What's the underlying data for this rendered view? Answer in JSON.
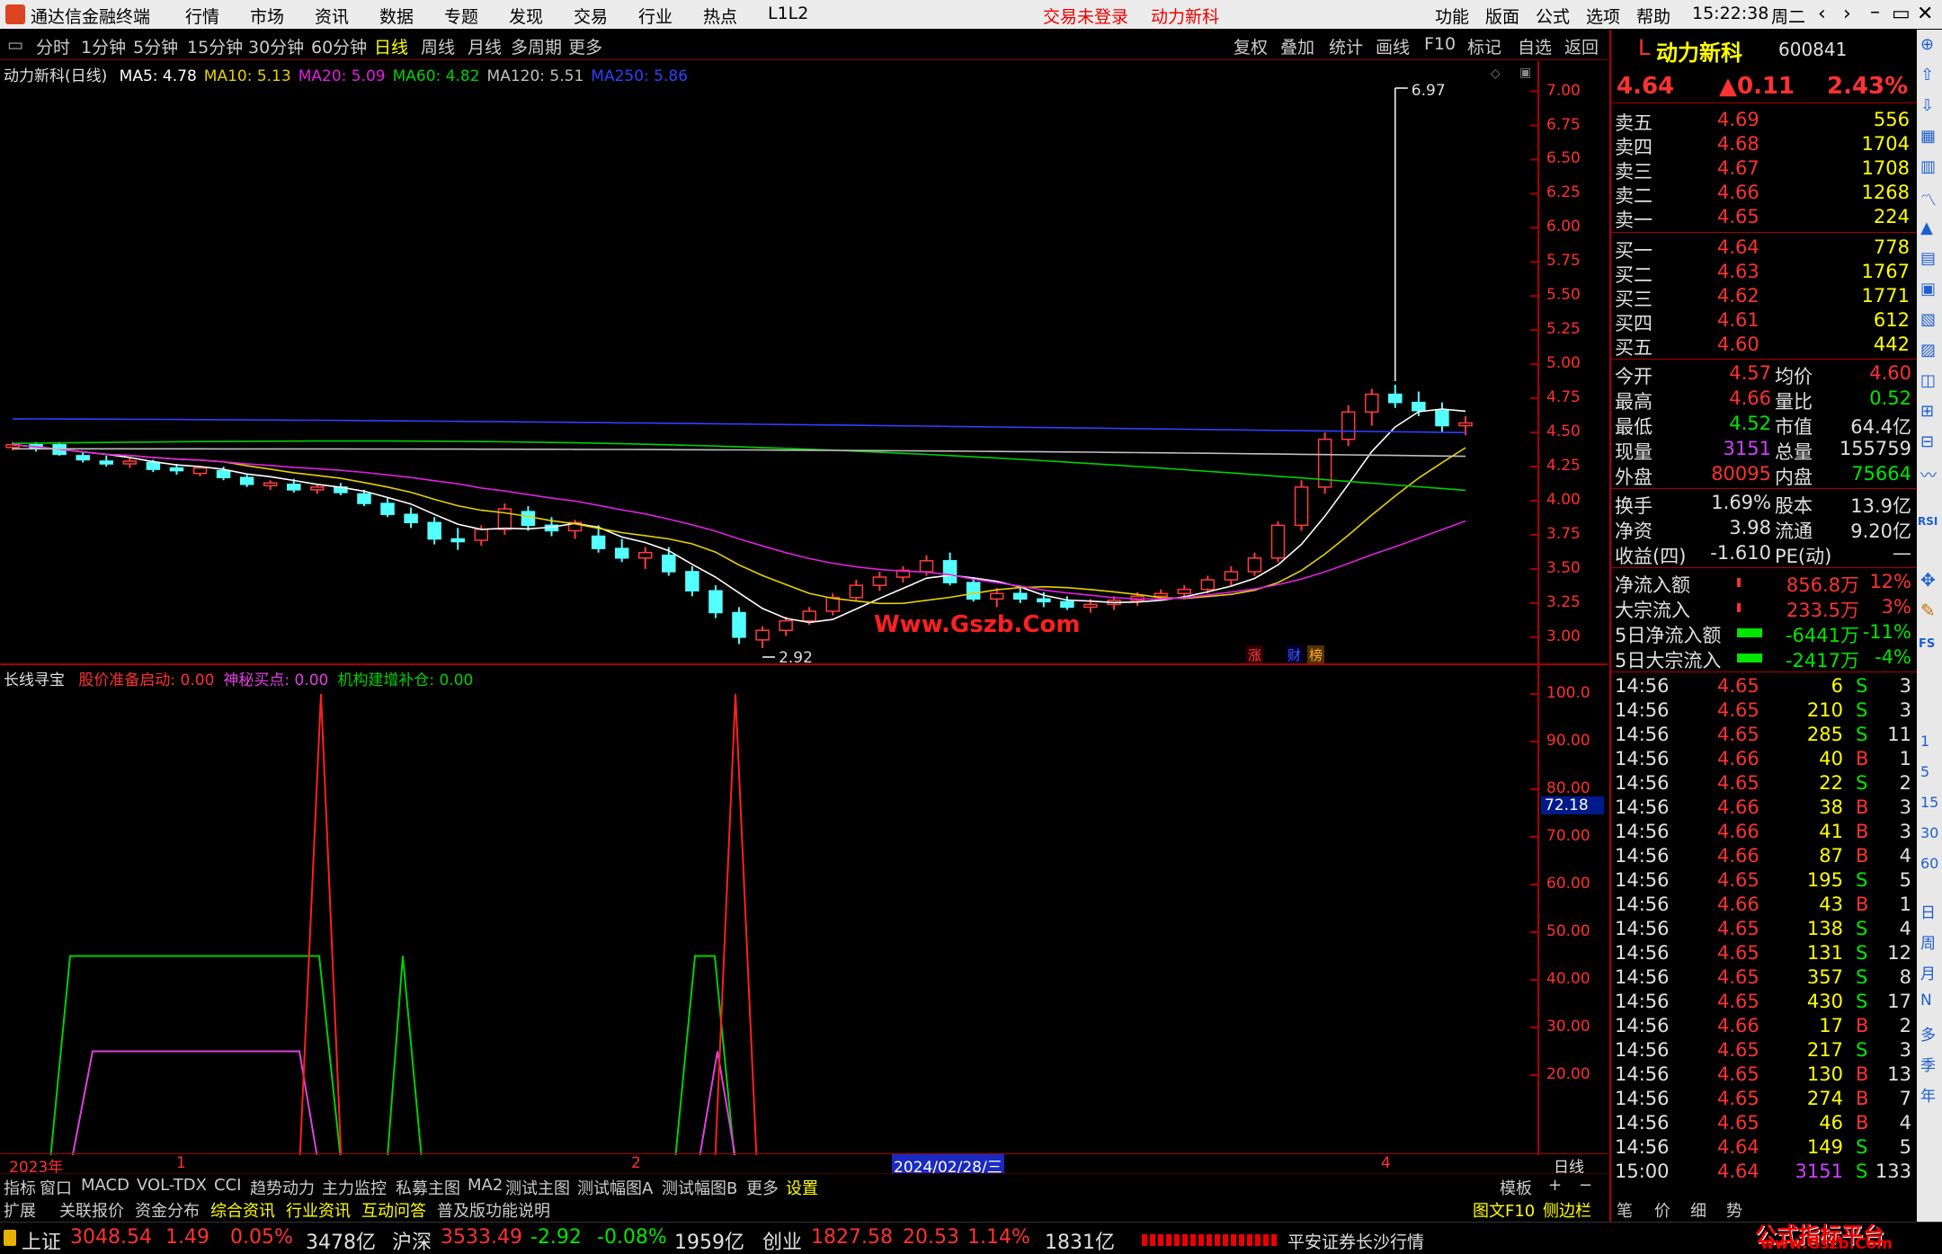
{
  "titlebar": {
    "app_name": "通达信金融终端",
    "menus": [
      "行情",
      "市场",
      "资讯",
      "数据",
      "专题",
      "发现",
      "交易",
      "行业",
      "热点",
      "L1L2"
    ],
    "login_status": "交易未登录",
    "stock_name_title": "动力新科",
    "right_menus": [
      "功能",
      "版面",
      "公式",
      "选项",
      "帮助"
    ],
    "time": "15:22:38",
    "weekday": "周二"
  },
  "toolbar": {
    "periods": [
      "分时",
      "1分钟",
      "5分钟",
      "15分钟",
      "30分钟",
      "60分钟",
      "日线",
      "周线",
      "月线",
      "多周期",
      "更多"
    ],
    "active_period": "日线",
    "actions": [
      "复权",
      "叠加",
      "统计",
      "画线",
      "F10",
      "标记",
      "自选",
      "返回"
    ]
  },
  "main_chart": {
    "title": "动力新科(日线)",
    "ma_labels": [
      {
        "label": "MA5: 4.78",
        "color": "#ffffff"
      },
      {
        "label": "MA10: 5.13",
        "color": "#e8d000"
      },
      {
        "label": "MA20: 5.09",
        "color": "#e020e0"
      },
      {
        "label": "MA60: 4.82",
        "color": "#00d000"
      },
      {
        "label": "MA120: 5.51",
        "color": "#c0c0c0"
      },
      {
        "label": "MA250: 5.86",
        "color": "#3040ff"
      }
    ],
    "y_ticks": [
      "7.00",
      "6.75",
      "6.50",
      "6.25",
      "6.00",
      "5.75",
      "5.50",
      "5.25",
      "5.00",
      "4.75",
      "4.50",
      "4.25",
      "4.00",
      "3.75",
      "3.50",
      "3.25",
      "3.00"
    ],
    "high_marker": "6.97",
    "low_marker": "2.92",
    "watermark": "Www.Gszb.Com",
    "badges": [
      "涨",
      "财",
      "榜"
    ]
  },
  "chart_data": {
    "type": "candlestick",
    "ylim": [
      2.9,
      7.05
    ],
    "candles": [
      [
        4.39,
        4.43,
        4.37,
        4.41
      ],
      [
        4.41,
        4.43,
        4.36,
        4.38
      ],
      [
        4.41,
        4.43,
        4.33,
        4.34
      ],
      [
        4.33,
        4.36,
        4.28,
        4.3
      ],
      [
        4.29,
        4.33,
        4.25,
        4.27
      ],
      [
        4.27,
        4.31,
        4.24,
        4.29
      ],
      [
        4.28,
        4.3,
        4.21,
        4.23
      ],
      [
        4.24,
        4.27,
        4.19,
        4.22
      ],
      [
        4.2,
        4.25,
        4.18,
        4.24
      ],
      [
        4.22,
        4.25,
        4.15,
        4.17
      ],
      [
        4.17,
        4.19,
        4.1,
        4.12
      ],
      [
        4.11,
        4.15,
        4.08,
        4.13
      ],
      [
        4.12,
        4.16,
        4.06,
        4.08
      ],
      [
        4.08,
        4.12,
        4.05,
        4.1
      ],
      [
        4.1,
        4.13,
        4.04,
        4.06
      ],
      [
        4.05,
        4.08,
        3.96,
        3.98
      ],
      [
        3.98,
        4.02,
        3.88,
        3.9
      ],
      [
        3.9,
        3.95,
        3.8,
        3.84
      ],
      [
        3.84,
        3.88,
        3.68,
        3.72
      ],
      [
        3.72,
        3.8,
        3.64,
        3.7
      ],
      [
        3.71,
        3.82,
        3.67,
        3.79
      ],
      [
        3.79,
        3.98,
        3.75,
        3.94
      ],
      [
        3.92,
        3.96,
        3.78,
        3.82
      ],
      [
        3.82,
        3.88,
        3.74,
        3.78
      ],
      [
        3.78,
        3.86,
        3.72,
        3.84
      ],
      [
        3.74,
        3.82,
        3.62,
        3.65
      ],
      [
        3.65,
        3.72,
        3.55,
        3.58
      ],
      [
        3.58,
        3.66,
        3.5,
        3.62
      ],
      [
        3.6,
        3.66,
        3.45,
        3.48
      ],
      [
        3.48,
        3.52,
        3.3,
        3.34
      ],
      [
        3.34,
        3.38,
        3.14,
        3.18
      ],
      [
        3.18,
        3.22,
        2.95,
        3.0
      ],
      [
        2.98,
        3.08,
        2.92,
        3.05
      ],
      [
        3.05,
        3.15,
        3.01,
        3.12
      ],
      [
        3.12,
        3.22,
        3.09,
        3.19
      ],
      [
        3.19,
        3.32,
        3.16,
        3.29
      ],
      [
        3.29,
        3.42,
        3.26,
        3.38
      ],
      [
        3.38,
        3.48,
        3.34,
        3.44
      ],
      [
        3.44,
        3.52,
        3.4,
        3.49
      ],
      [
        3.48,
        3.6,
        3.45,
        3.56
      ],
      [
        3.56,
        3.62,
        3.38,
        3.4
      ],
      [
        3.4,
        3.44,
        3.26,
        3.28
      ],
      [
        3.28,
        3.36,
        3.22,
        3.32
      ],
      [
        3.32,
        3.38,
        3.25,
        3.28
      ],
      [
        3.28,
        3.33,
        3.22,
        3.26
      ],
      [
        3.26,
        3.3,
        3.2,
        3.22
      ],
      [
        3.22,
        3.28,
        3.18,
        3.24
      ],
      [
        3.24,
        3.3,
        3.2,
        3.27
      ],
      [
        3.27,
        3.33,
        3.23,
        3.3
      ],
      [
        3.3,
        3.35,
        3.27,
        3.32
      ],
      [
        3.32,
        3.38,
        3.28,
        3.35
      ],
      [
        3.35,
        3.45,
        3.32,
        3.42
      ],
      [
        3.42,
        3.52,
        3.38,
        3.48
      ],
      [
        3.48,
        3.62,
        3.45,
        3.58
      ],
      [
        3.58,
        3.85,
        3.55,
        3.82
      ],
      [
        3.82,
        4.15,
        3.78,
        4.1
      ],
      [
        4.1,
        4.5,
        4.05,
        4.45
      ],
      [
        4.45,
        4.7,
        4.4,
        4.65
      ],
      [
        4.65,
        4.82,
        4.55,
        4.78
      ],
      [
        4.78,
        4.85,
        4.68,
        4.72
      ],
      [
        4.72,
        4.8,
        4.62,
        4.66
      ],
      [
        4.66,
        4.72,
        4.5,
        4.55
      ],
      [
        4.55,
        4.62,
        4.48,
        4.57
      ]
    ]
  },
  "sub_chart": {
    "title": "长线寻宝",
    "labels": [
      {
        "label": "股价准备启动: 0.00",
        "color": "#ff3030"
      },
      {
        "label": "神秘买点: 0.00",
        "color": "#e040e0"
      },
      {
        "label": "机构建增补仓: 0.00",
        "color": "#00d000"
      }
    ],
    "y_ticks": [
      "100.0",
      "90.00",
      "80.00",
      "70.00",
      "60.00",
      "50.00",
      "40.00",
      "30.00",
      "20.00"
    ],
    "cursor_value": "72.18",
    "x_labels": [
      "2023年",
      "1",
      "2",
      "2024/02/28/三",
      "4"
    ],
    "period_label": "日线"
  },
  "quote": {
    "code_prefix": "L",
    "name": "动力新科",
    "code": "600841",
    "price": "4.64",
    "change": "▲0.11",
    "change_pct": "2.43%",
    "asks": [
      {
        "label": "卖五",
        "price": "4.69",
        "vol": "556"
      },
      {
        "label": "卖四",
        "price": "4.68",
        "vol": "1704"
      },
      {
        "label": "卖三",
        "price": "4.67",
        "vol": "1708"
      },
      {
        "label": "卖二",
        "price": "4.66",
        "vol": "1268"
      },
      {
        "label": "卖一",
        "price": "4.65",
        "vol": "224"
      }
    ],
    "bids": [
      {
        "label": "买一",
        "price": "4.64",
        "vol": "778"
      },
      {
        "label": "买二",
        "price": "4.63",
        "vol": "1767"
      },
      {
        "label": "买三",
        "price": "4.62",
        "vol": "1771"
      },
      {
        "label": "买四",
        "price": "4.61",
        "vol": "612"
      },
      {
        "label": "买五",
        "price": "4.60",
        "vol": "442"
      }
    ],
    "stats": [
      {
        "l1": "今开",
        "v1": "4.57",
        "l2": "均价",
        "v2": "4.60",
        "c1": "red",
        "c2": "red"
      },
      {
        "l1": "最高",
        "v1": "4.66",
        "l2": "量比",
        "v2": "0.52",
        "c1": "red",
        "c2": "green"
      },
      {
        "l1": "最低",
        "v1": "4.52",
        "l2": "市值",
        "v2": "64.4亿",
        "c1": "green",
        "c2": "white"
      },
      {
        "l1": "现量",
        "v1": "3151",
        "l2": "总量",
        "v2": "155759",
        "c1": "purple",
        "c2": "white"
      },
      {
        "l1": "外盘",
        "v1": "80095",
        "l2": "内盘",
        "v2": "75664",
        "c1": "red",
        "c2": "green"
      }
    ],
    "stats2": [
      {
        "l1": "换手",
        "v1": "1.69%",
        "l2": "股本",
        "v2": "13.9亿"
      },
      {
        "l1": "净资",
        "v1": "3.98",
        "l2": "流通",
        "v2": "9.20亿"
      },
      {
        "l1": "收益(四)",
        "v1": "-1.610",
        "l2": "PE(动)",
        "v2": "—"
      }
    ],
    "flows": [
      {
        "label": "净流入额",
        "value": "856.8万",
        "pct": "12%",
        "color": "red"
      },
      {
        "label": "大宗流入",
        "value": "233.5万",
        "pct": "3%",
        "color": "red"
      },
      {
        "label": "5日净流入额",
        "value": "-6441万",
        "pct": "-11%",
        "color": "green"
      },
      {
        "label": "5日大宗流入",
        "value": "-2417万",
        "pct": "-4%",
        "color": "green"
      }
    ]
  },
  "ticks": [
    [
      "14:56",
      "4.65",
      "6",
      "S",
      "3"
    ],
    [
      "14:56",
      "4.65",
      "210",
      "S",
      "3"
    ],
    [
      "14:56",
      "4.65",
      "285",
      "S",
      "11"
    ],
    [
      "14:56",
      "4.66",
      "40",
      "B",
      "1"
    ],
    [
      "14:56",
      "4.65",
      "22",
      "S",
      "2"
    ],
    [
      "14:56",
      "4.66",
      "38",
      "B",
      "3"
    ],
    [
      "14:56",
      "4.66",
      "41",
      "B",
      "3"
    ],
    [
      "14:56",
      "4.66",
      "87",
      "B",
      "4"
    ],
    [
      "14:56",
      "4.65",
      "195",
      "S",
      "5"
    ],
    [
      "14:56",
      "4.66",
      "43",
      "B",
      "1"
    ],
    [
      "14:56",
      "4.65",
      "138",
      "S",
      "4"
    ],
    [
      "14:56",
      "4.65",
      "131",
      "S",
      "12"
    ],
    [
      "14:56",
      "4.65",
      "357",
      "S",
      "8"
    ],
    [
      "14:56",
      "4.65",
      "430",
      "S",
      "17"
    ],
    [
      "14:56",
      "4.66",
      "17",
      "B",
      "2"
    ],
    [
      "14:56",
      "4.65",
      "217",
      "S",
      "3"
    ],
    [
      "14:56",
      "4.65",
      "130",
      "B",
      "13"
    ],
    [
      "14:56",
      "4.65",
      "274",
      "B",
      "7"
    ],
    [
      "14:56",
      "4.65",
      "46",
      "B",
      "4"
    ],
    [
      "14:56",
      "4.64",
      "149",
      "S",
      "5"
    ],
    [
      "15:00",
      "4.64",
      "3151",
      "S",
      "133"
    ]
  ],
  "bottom_tabs": [
    "指标",
    "窗口",
    "MACD",
    "VOL-TDX",
    "CCI",
    "趋势动力",
    "主力监控",
    "私募主图",
    "MA2",
    "测试主图",
    "测试幅图A",
    "测试幅图B",
    "更多",
    "设置"
  ],
  "bottom_tabs_right": [
    "模板",
    "+",
    "−"
  ],
  "bottom_tabs2": [
    "扩展",
    "关联报价",
    "资金分布",
    "综合资讯",
    "行业资讯",
    "互动问答",
    "普及版功能说明"
  ],
  "bottom_tabs2_right": [
    "图文F10",
    "侧边栏",
    "笔",
    "价",
    "细",
    "势"
  ],
  "sidebar_labels": [
    "日",
    "周",
    "月",
    "N",
    "多",
    "季",
    "年"
  ],
  "sidebar_nums": [
    "1",
    "5",
    "15",
    "30",
    "60"
  ],
  "statusbar": {
    "sh": {
      "name": "上证",
      "value": "3048.54",
      "chg": "1.49",
      "pct": "0.05%",
      "amt": "3478亿"
    },
    "hs": {
      "name": "沪深",
      "value": "3533.49",
      "chg": "-2.92",
      "pct": "-0.08%",
      "amt": "1959亿"
    },
    "cy": {
      "name": "创业",
      "value": "1827.58",
      "chg": "20.53",
      "pct": "1.14%",
      "amt": "1831亿"
    },
    "broker": "平安证券长沙行情",
    "watermark": "公式指标平台",
    "watermark_url": "www.Gszb.Com"
  }
}
